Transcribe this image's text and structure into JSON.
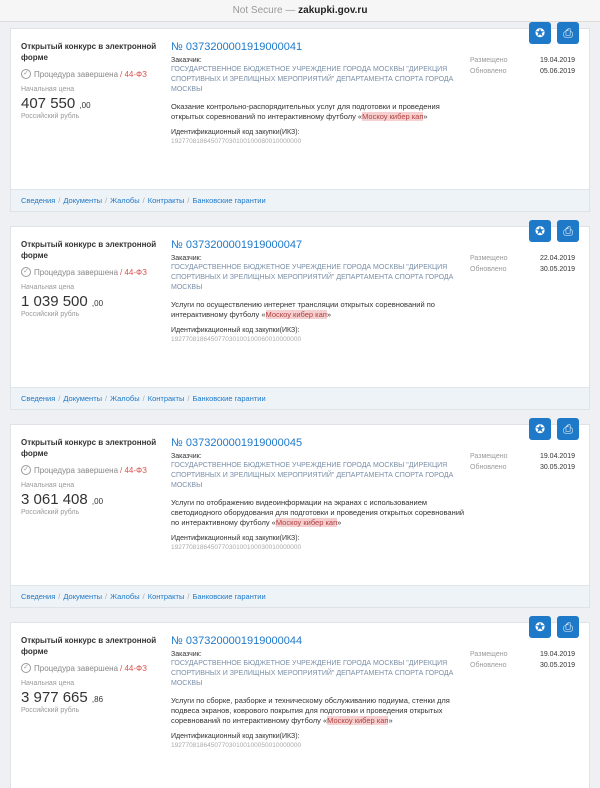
{
  "browser": {
    "security": "Not Secure —",
    "host": "zakupki.gov.ru"
  },
  "icons": {
    "award": "award-icon",
    "print": "print-icon"
  },
  "tabs": [
    "Сведения",
    "Документы",
    "Жалобы",
    "Контракты",
    "Банковские гарантии"
  ],
  "labels": {
    "status": "Процедура завершена",
    "law": "44-ФЗ",
    "price_label": "Начальная цена",
    "currency": "Российский рубль",
    "customer_label": "Заказчик:",
    "ikz_label": "Идентификационный код закупки(ИКЗ):",
    "posted": "Размещено",
    "updated": "Обновлено",
    "highlight": "Москоу кибер кап"
  },
  "cards": [
    {
      "type": "Открытый конкурс в электронной форме",
      "price": "407 550",
      "cents": ",00",
      "number": "№ 0373200001919000041",
      "customer": "ГОСУДАРСТВЕННОЕ БЮДЖЕТНОЕ УЧРЕЖДЕНИЕ ГОРОДА МОСКВЫ \"ДИРЕКЦИЯ СПОРТИВНЫХ И ЗРЕЛИЩНЫХ МЕРОПРИЯТИЙ\" ДЕПАРТАМЕНТА СПОРТА ГОРОДА МОСКВЫ",
      "desc": "Оказание контрольно-распорядительных услуг для подготовки и проведения открытых соревнований по интерактивному футболу «",
      "desc_end": "»",
      "ikz": "192770818645077030100100080010000000",
      "posted": "19.04.2019",
      "updated": "05.06.2019"
    },
    {
      "type": "Открытый конкурс в электронной форме",
      "price": "1 039 500",
      "cents": ",00",
      "number": "№ 0373200001919000047",
      "customer": "ГОСУДАРСТВЕННОЕ БЮДЖЕТНОЕ УЧРЕЖДЕНИЕ ГОРОДА МОСКВЫ \"ДИРЕКЦИЯ СПОРТИВНЫХ И ЗРЕЛИЩНЫХ МЕРОПРИЯТИЙ\" ДЕПАРТАМЕНТА СПОРТА ГОРОДА МОСКВЫ",
      "desc": "Услуги по осуществлению интернет трансляции открытых соревнований по интерактивному футболу «",
      "desc_end": "»",
      "ikz": "192770818645077030100100060010000000",
      "posted": "22.04.2019",
      "updated": "30.05.2019"
    },
    {
      "type": "Открытый конкурс в электронной форме",
      "price": "3 061 408",
      "cents": ",00",
      "number": "№ 0373200001919000045",
      "customer": "ГОСУДАРСТВЕННОЕ БЮДЖЕТНОЕ УЧРЕЖДЕНИЕ ГОРОДА МОСКВЫ \"ДИРЕКЦИЯ СПОРТИВНЫХ И ЗРЕЛИЩНЫХ МЕРОПРИЯТИЙ\" ДЕПАРТАМЕНТА СПОРТА ГОРОДА МОСКВЫ",
      "desc": "Услуги по отображению видеоинформации на экранах с использованием светодиодного оборудования для подготовки и проведения открытых соревнований по интерактивному футболу «",
      "desc_end": "»",
      "ikz": "192770818645077030100100030010000000",
      "posted": "19.04.2019",
      "updated": "30.05.2019"
    },
    {
      "type": "Открытый конкурс в электронной форме",
      "price": "3 977 665",
      "cents": ",86",
      "number": "№ 0373200001919000044",
      "customer": "ГОСУДАРСТВЕННОЕ БЮДЖЕТНОЕ УЧРЕЖДЕНИЕ ГОРОДА МОСКВЫ \"ДИРЕКЦИЯ СПОРТИВНЫХ И ЗРЕЛИЩНЫХ МЕРОПРИЯТИЙ\" ДЕПАРТАМЕНТА СПОРТА ГОРОДА МОСКВЫ",
      "desc": "Услуги по сборке, разборке и техническому обслуживанию подиума, стенки для подвеса экранов, коврового покрытия для подготовки и проведения открытых соревнований по интерактивному футболу «",
      "desc_end": "»",
      "ikz": "192770818645077030100100050010000000",
      "posted": "19.04.2019",
      "updated": "30.05.2019"
    }
  ]
}
